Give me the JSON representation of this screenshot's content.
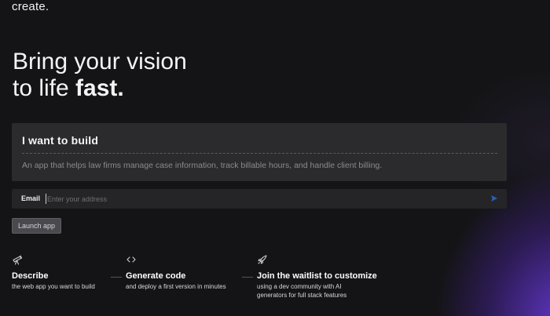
{
  "brand": {
    "logo_text": "create."
  },
  "hero": {
    "line1": "Bring your vision",
    "line2_prefix": "to life ",
    "line2_bold": "fast."
  },
  "build": {
    "title": "I want to build",
    "description": "An app that helps law firms manage case information, track billable hours, and handle client billing."
  },
  "email": {
    "label": "Email",
    "placeholder": "Enter your address",
    "value": ""
  },
  "launch": {
    "label": "Launch app"
  },
  "steps": [
    {
      "icon": "telescope-icon",
      "title": "Describe",
      "desc": [
        "the web app you want to build"
      ]
    },
    {
      "icon": "code-brackets-icon",
      "title": "Generate code",
      "desc": [
        "and deploy a first version in minutes"
      ]
    },
    {
      "icon": "rocket-icon",
      "title": "Join the waitlist to customize",
      "desc": [
        "using a dev community with AI",
        "generators for full stack features"
      ]
    }
  ],
  "colors": {
    "background": "#141416",
    "accent_glow": "#6e3ce6",
    "submit_arrow": "#2d5fb8"
  }
}
